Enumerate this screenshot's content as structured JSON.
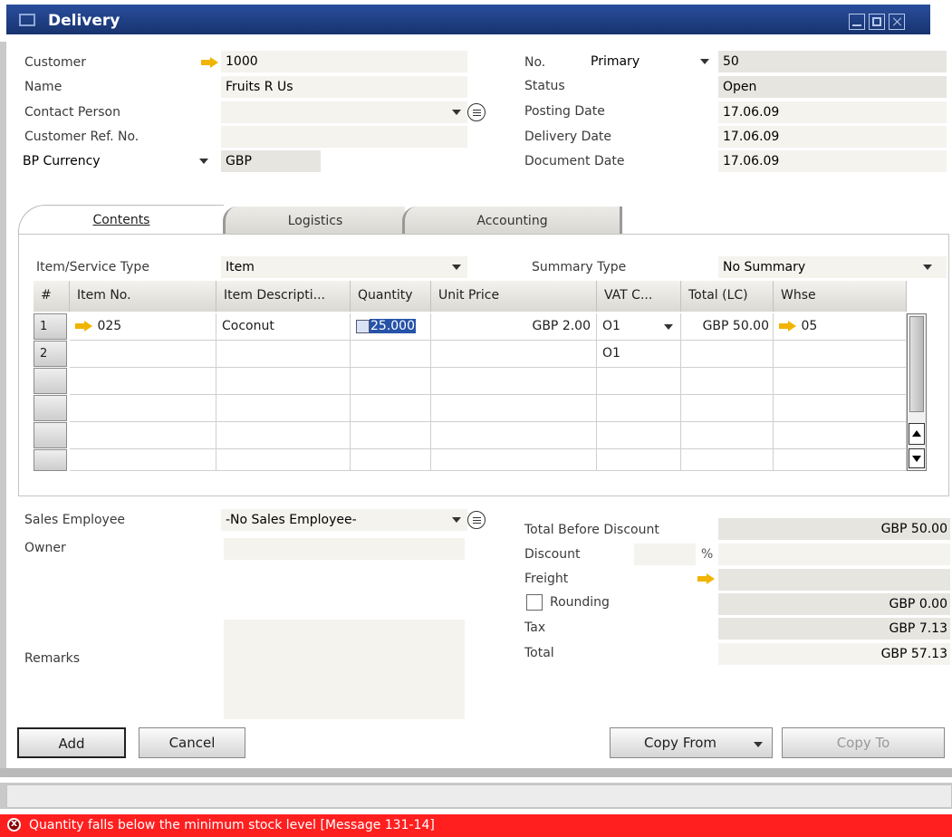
{
  "window": {
    "title": "Delivery"
  },
  "header_left": {
    "customer_label": "Customer",
    "customer_value": "1000",
    "name_label": "Name",
    "name_value": "Fruits R Us",
    "contact_label": "Contact Person",
    "contact_value": "",
    "custref_label": "Customer Ref. No.",
    "custref_value": "",
    "currency_label": "BP Currency",
    "currency_value": "GBP"
  },
  "header_right": {
    "no_label": "No.",
    "series_value": "Primary",
    "no_value": "50",
    "status_label": "Status",
    "status_value": "Open",
    "posting_label": "Posting Date",
    "posting_value": "17.06.09",
    "delivery_label": "Delivery Date",
    "delivery_value": "17.06.09",
    "document_label": "Document Date",
    "document_value": "17.06.09"
  },
  "tabs": [
    "Contents",
    "Logistics",
    "Accounting"
  ],
  "contents": {
    "item_type_label": "Item/Service Type",
    "item_type_value": "Item",
    "summary_label": "Summary Type",
    "summary_value": "No Summary"
  },
  "grid": {
    "columns": [
      "#",
      "Item No.",
      "Item Descripti...",
      "Quantity",
      "Unit Price",
      "VAT C...",
      "Total (LC)",
      "Whse"
    ],
    "rows": [
      {
        "num": "1",
        "item_no": "025",
        "desc": "Coconut",
        "qty": "25.000",
        "price": "GBP 2.00",
        "vat": "O1",
        "total": "GBP 50.00",
        "whse": "05"
      },
      {
        "num": "2",
        "item_no": "",
        "desc": "",
        "qty": "",
        "price": "",
        "vat": "O1",
        "total": "",
        "whse": ""
      }
    ]
  },
  "footer_left": {
    "sales_emp_label": "Sales Employee",
    "sales_emp_value": "-No Sales Employee-",
    "owner_label": "Owner",
    "owner_value": "",
    "remarks_label": "Remarks",
    "remarks_value": ""
  },
  "totals": {
    "before_discount_label": "Total Before Discount",
    "before_discount_value": "GBP 50.00",
    "discount_label": "Discount",
    "discount_pct_symbol": "%",
    "discount_value": "",
    "freight_label": "Freight",
    "freight_value": "",
    "rounding_label": "Rounding",
    "rounding_value": "GBP 0.00",
    "tax_label": "Tax",
    "tax_value": "GBP 7.13",
    "total_label": "Total",
    "total_value": "GBP 57.13"
  },
  "buttons": {
    "add": "Add",
    "cancel": "Cancel",
    "copy_from": "Copy From",
    "copy_to": "Copy To"
  },
  "status_bar": {
    "message": "Quantity falls below the minimum stock level  [Message 131-14]"
  },
  "colors": {
    "title_bar": "#1f4288",
    "error_bar": "#ff1f1f",
    "arrow": "#f1b400"
  }
}
